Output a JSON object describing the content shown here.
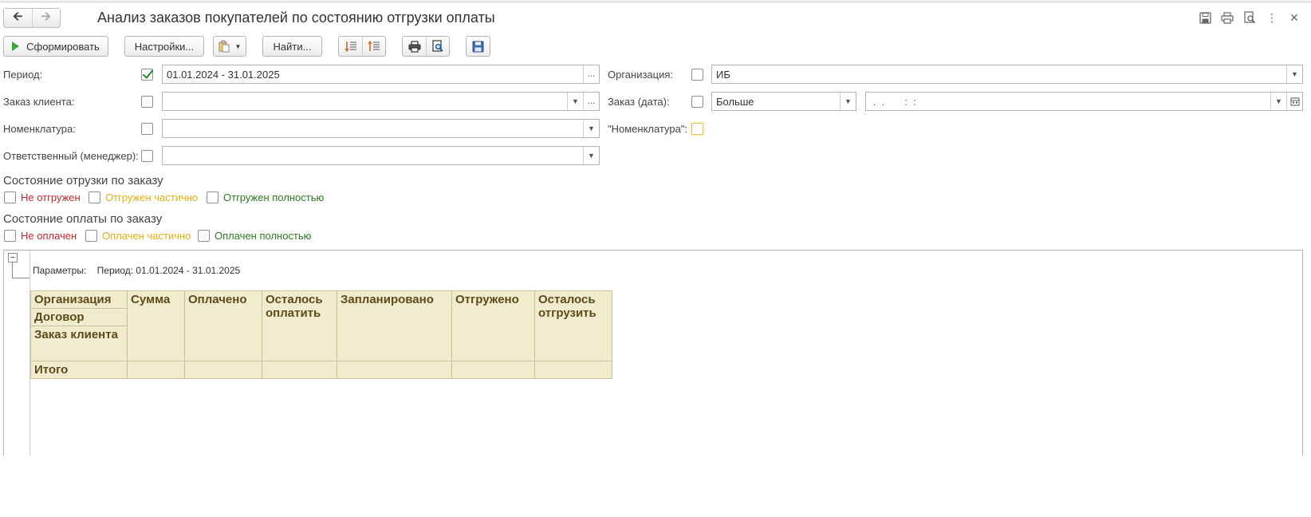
{
  "window": {
    "title": "Анализ заказов покупателей по состоянию отгрузки оплаты"
  },
  "toolbar": {
    "generate_label": "Сформировать",
    "settings_label": "Настройки...",
    "find_label": "Найти..."
  },
  "filters": {
    "period": {
      "label": "Период:",
      "checked": true,
      "value": "01.01.2024 - 31.01.2025"
    },
    "organization": {
      "label": "Организация:",
      "checked": false,
      "value": "ИБ"
    },
    "client_order": {
      "label": "Заказ клиента:",
      "checked": false,
      "value": ""
    },
    "order_date": {
      "label": "Заказ (дата):",
      "checked": false,
      "condition": "Больше",
      "value": " .  .       :  :"
    },
    "nomenclature": {
      "label": "Номенклатура:",
      "checked": false,
      "value": ""
    },
    "nomenclature_flag": {
      "label": "\"Номенклатура\":",
      "checked": false
    },
    "manager": {
      "label": "Ответственный (менеджер):",
      "checked": false,
      "value": ""
    }
  },
  "shipment_state": {
    "title": "Состояние отрузки по заказу",
    "options": [
      {
        "label": "Не отгружен",
        "color": "#c0282d"
      },
      {
        "label": "Отгружен частично",
        "color": "#e5b012"
      },
      {
        "label": "Отгружен полностью",
        "color": "#2d7a1e"
      }
    ]
  },
  "payment_state": {
    "title": "Состояние оплаты по заказу",
    "options": [
      {
        "label": "Не оплачен",
        "color": "#c0282d"
      },
      {
        "label": "Оплачен частично",
        "color": "#e5b012"
      },
      {
        "label": "Оплачен полностью",
        "color": "#2d7a1e"
      }
    ]
  },
  "report": {
    "params_label": "Параметры:",
    "params_value": "Период: 01.01.2024 - 31.01.2025",
    "headers": {
      "organization": "Организация",
      "contract": "Договор",
      "client_order": "Заказ клиента",
      "sum": "Сумма",
      "paid": "Оплачено",
      "to_pay": "Осталось оплатить",
      "planned": "Запланировано",
      "shipped": "Отгружено",
      "to_ship": "Осталось отгрузить"
    },
    "total_label": "Итого"
  },
  "icons": {
    "back": "arrow-left-icon",
    "forward": "arrow-right-icon",
    "save": "floppy-icon",
    "print": "printer-icon",
    "preview": "print-preview-icon",
    "more": "more-vertical-icon",
    "close": "close-icon"
  }
}
